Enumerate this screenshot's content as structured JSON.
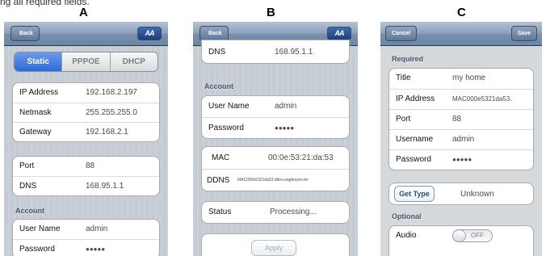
{
  "caption": {
    "prev_text": "ng all required fields.",
    "labels": [
      "A",
      "B",
      "C"
    ]
  },
  "panel_a": {
    "back_label": "Back",
    "logo_text": "AA",
    "segments": [
      "Static",
      "PPPOE",
      "DHCP"
    ],
    "active_segment": "Static",
    "network": [
      {
        "label": "IP Address",
        "value": "192.168.2.197"
      },
      {
        "label": "Netmask",
        "value": "255.255.255.0"
      },
      {
        "label": "Gateway",
        "value": "192.168.2.1"
      }
    ],
    "server": [
      {
        "label": "Port",
        "value": "88"
      },
      {
        "label": "DNS",
        "value": "168.95.1.1"
      }
    ],
    "account_header": "Account",
    "account": [
      {
        "label": "User Name",
        "value": "admin"
      },
      {
        "label": "Password",
        "value": "●●●●●"
      }
    ]
  },
  "panel_b": {
    "back_label": "Back",
    "logo_text": "AA",
    "dns": {
      "label": "DNS",
      "value": "168.95.1.1"
    },
    "account_header": "Account",
    "account": [
      {
        "label": "User Name",
        "value": "admin"
      },
      {
        "label": "Password",
        "value": "●●●●●"
      }
    ],
    "mac": {
      "label": "MAC",
      "value": "00:0e:53:21:da:53"
    },
    "ddns": {
      "label": "DDNS",
      "value": "MAC000e5321da53.ddns.eagleeyes.tw"
    },
    "status": {
      "label": "Status",
      "value": "Processing..."
    },
    "apply_label": "Apply"
  },
  "panel_c": {
    "cancel_label": "Cancel",
    "save_label": "Save",
    "required_header": "Required",
    "required": [
      {
        "label": "Title",
        "value": "my home"
      },
      {
        "label": "IP Address",
        "value": "MAC000e5321da53."
      },
      {
        "label": "Port",
        "value": "88"
      },
      {
        "label": "Username",
        "value": "admin"
      },
      {
        "label": "Password",
        "value": "●●●●●"
      }
    ],
    "get_type_label": "Get Type",
    "get_type_value": "Unknown",
    "optional_header": "Optional",
    "audio_label": "Audio",
    "audio_state": "OFF"
  }
}
